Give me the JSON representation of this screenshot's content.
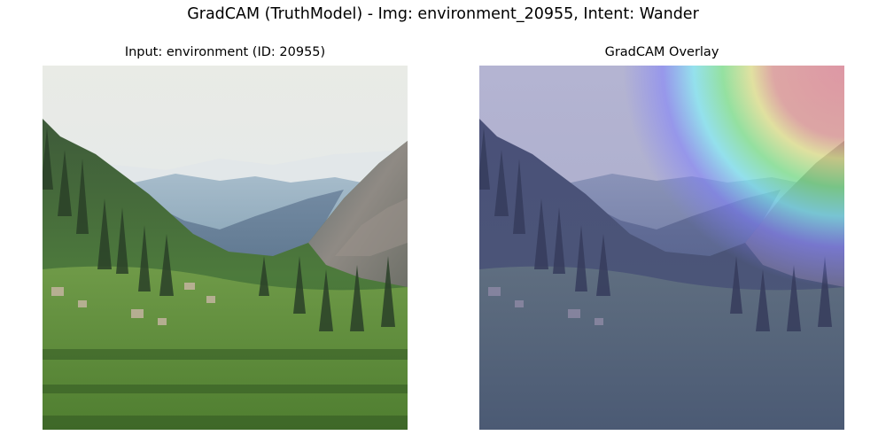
{
  "figure": {
    "title": "GradCAM (TruthModel) - Img: environment_20955, Intent: Wander"
  },
  "panels": {
    "input": {
      "title": "Input: environment (ID: 20955)"
    },
    "overlay": {
      "title": "GradCAM Overlay"
    }
  },
  "overlay_tint": "#5a5aa0",
  "heatmap_colors": [
    "#8080ff",
    "#80ffff",
    "#80ff80",
    "#ffff80",
    "#ffb080",
    "#ff8080"
  ]
}
